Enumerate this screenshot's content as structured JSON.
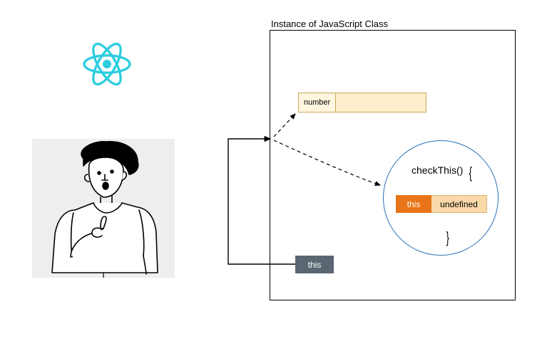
{
  "class_title": "Instance of JavaScript Class",
  "number_label": "number",
  "number_value": "",
  "circle": {
    "method": "checkThis()",
    "brace_open": "{",
    "brace_close": "}",
    "this_key": "this",
    "this_value": "undefined"
  },
  "outer_this": "this",
  "colors": {
    "react": "#2ccde0",
    "this_key_bg": "#e87417",
    "outer_this_bg": "#5a6671"
  }
}
